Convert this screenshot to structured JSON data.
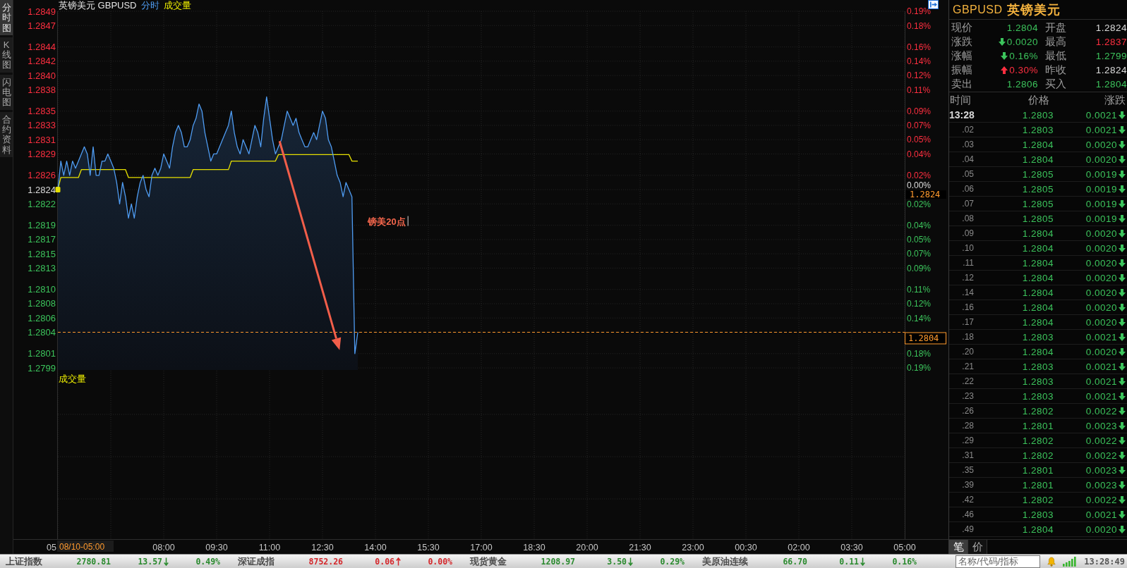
{
  "view_tabs": [
    {
      "label": "分时图",
      "selected": true
    },
    {
      "label": "K线图",
      "selected": false
    },
    {
      "label": "闪电图",
      "selected": false
    },
    {
      "label": "合约资料",
      "selected": false
    }
  ],
  "chart": {
    "volume_legend": "成交量",
    "volume_label": "成交量",
    "reference_tag": "1.2824",
    "crosshair_time": "08/10-05:00",
    "first_time_label": "05",
    "percent_axis": [
      "0.19%",
      "0.18%",
      "0.16%",
      "0.14%",
      "0.12%",
      "0.11%",
      "0.09%",
      "0.07%",
      "0.05%",
      "0.04%",
      "0.02%",
      "0.00%",
      "0.02%",
      "0.04%",
      "0.05%",
      "0.07%",
      "0.09%",
      "0.11%",
      "0.12%",
      "0.14%",
      "0.18%",
      "0.19%"
    ],
    "chart_data": {
      "type": "line",
      "title": "英镑美元 GBPUSD",
      "grid": true,
      "categories": [
        null,
        null,
        null,
        null,
        null,
        null,
        null,
        null,
        null,
        null,
        null,
        null,
        null,
        null,
        null,
        null,
        null,
        null,
        null,
        null,
        null,
        null,
        null,
        null,
        null,
        null,
        null,
        null,
        null,
        null,
        null,
        null,
        null,
        null,
        null,
        null,
        "08:00",
        null,
        null,
        null,
        null,
        null,
        null,
        null,
        null,
        null,
        null,
        null,
        null,
        null,
        null,
        null,
        null,
        null,
        "09:30",
        null,
        null,
        null,
        null,
        null,
        null,
        null,
        null,
        null,
        null,
        null,
        null,
        null,
        null,
        null,
        null,
        null,
        "11:00",
        null,
        null,
        null,
        null,
        null,
        null,
        null,
        null,
        null,
        null,
        null,
        null,
        null,
        null,
        null,
        null,
        null,
        "12:30",
        null,
        null,
        null,
        null,
        null,
        null,
        null,
        null,
        null,
        null,
        null,
        null,
        null,
        null,
        null,
        null,
        null,
        "14:00",
        null,
        null,
        null,
        null,
        null,
        null,
        null,
        null,
        null,
        null,
        null,
        null,
        null,
        null,
        null,
        null,
        null,
        "15:30",
        null,
        null,
        null,
        null,
        null,
        null,
        null,
        null,
        null,
        null,
        null,
        null,
        null,
        null,
        null,
        null,
        null,
        "17:00",
        null,
        null,
        null,
        null,
        null,
        null,
        null,
        null,
        null,
        null,
        null,
        null,
        null,
        null,
        null,
        null,
        null,
        "18:30",
        null,
        null,
        null,
        null,
        null,
        null,
        null,
        null,
        null,
        null,
        null,
        null,
        null,
        null,
        null,
        null,
        null,
        "20:00",
        null,
        null,
        null,
        null,
        null,
        null,
        null,
        null,
        null,
        null,
        null,
        null,
        null,
        null,
        null,
        null,
        null,
        "21:30",
        null,
        null,
        null,
        null,
        null,
        null,
        null,
        null,
        null,
        null,
        null,
        null,
        null,
        null,
        null,
        null,
        null,
        "23:00",
        null,
        null,
        null,
        null,
        null,
        null,
        null,
        null,
        null,
        null,
        null,
        null,
        null,
        null,
        null,
        null,
        null,
        "00:30",
        null,
        null,
        null,
        null,
        null,
        null,
        null,
        null,
        null,
        null,
        null,
        null,
        null,
        null,
        null,
        null,
        null,
        "02:00",
        null,
        null,
        null,
        null,
        null,
        null,
        null,
        null,
        null,
        null,
        null,
        null,
        null,
        null,
        null,
        null,
        null,
        "03:30",
        null,
        null,
        null,
        null,
        null,
        null,
        null,
        null,
        null,
        null,
        null,
        null,
        null,
        null,
        null,
        null,
        null,
        "05:00"
      ],
      "series": [
        {
          "name": "分时",
          "color": "#4f9cf2",
          "values": [
            1.2824,
            1.2828,
            1.2826,
            1.2828,
            1.2826,
            1.2828,
            1.2827,
            1.2828,
            1.2829,
            1.283,
            1.2829,
            1.2826,
            1.283,
            1.2826,
            1.2826,
            1.2828,
            1.2828,
            1.2829,
            1.2828,
            1.2827,
            1.2825,
            1.2822,
            1.2825,
            1.2823,
            1.282,
            1.2822,
            1.282,
            1.2823,
            1.2825,
            1.2826,
            1.2824,
            1.2823,
            1.2826,
            1.2827,
            1.2826,
            1.2827,
            1.2829,
            1.2828,
            1.2827,
            1.283,
            1.2832,
            1.2833,
            1.2832,
            1.283,
            1.283,
            1.2831,
            1.2833,
            1.2834,
            1.2836,
            1.2835,
            1.2832,
            1.283,
            1.2828,
            1.2829,
            1.2829,
            1.283,
            1.2831,
            1.2832,
            1.2833,
            1.2835,
            1.2832,
            1.283,
            1.2829,
            1.2831,
            1.283,
            1.2829,
            1.2831,
            1.2833,
            1.2832,
            1.283,
            1.2834,
            1.2837,
            1.2834,
            1.2831,
            1.2829,
            1.283,
            1.2831,
            1.2833,
            1.2835,
            1.2834,
            1.2833,
            1.2834,
            1.2832,
            1.2831,
            1.283,
            1.283,
            1.2831,
            1.2832,
            1.2831,
            1.2833,
            1.2835,
            1.2834,
            1.2831,
            1.283,
            1.2828,
            1.2826,
            1.2825,
            1.2823,
            1.2825,
            1.2824,
            1.2823,
            1.2801,
            1.2804,
            null,
            null,
            null,
            null,
            null,
            null,
            null,
            null,
            null,
            null,
            null,
            null,
            null,
            null,
            null,
            null,
            null,
            null,
            null,
            null,
            null,
            null,
            null,
            null,
            null,
            null,
            null,
            null,
            null,
            null,
            null,
            null,
            null,
            null,
            null,
            null,
            null,
            null,
            null,
            null,
            null,
            null,
            null,
            null,
            null,
            null,
            null,
            null,
            null,
            null,
            null,
            null,
            null,
            null,
            null,
            null,
            null,
            null,
            null,
            null,
            null,
            null,
            null,
            null,
            null,
            null,
            null,
            null,
            null,
            null,
            null,
            null,
            null,
            null,
            null,
            null,
            null,
            null,
            null,
            null,
            null,
            null,
            null,
            null,
            null,
            null,
            null,
            null,
            null,
            null,
            null,
            null,
            null,
            null,
            null,
            null,
            null,
            null,
            null,
            null,
            null,
            null,
            null,
            null,
            null,
            null,
            null,
            null,
            null,
            null,
            null,
            null,
            null,
            null,
            null,
            null,
            null,
            null,
            null,
            null,
            null,
            null,
            null,
            null,
            null,
            null,
            null,
            null,
            null,
            null,
            null,
            null,
            null,
            null,
            null,
            null,
            null,
            null,
            null,
            null,
            null,
            null,
            null,
            null,
            null,
            null,
            null,
            null,
            null,
            null,
            null,
            null,
            null,
            null,
            null,
            null,
            null,
            null,
            null,
            null,
            null,
            null,
            null,
            null,
            null,
            null,
            null,
            null,
            null,
            null,
            null,
            null,
            null,
            null,
            null,
            null,
            null,
            null,
            null,
            null,
            null,
            null,
            null,
            null,
            null,
            null
          ]
        },
        {
          "color": "#e6e000",
          "values": [
            1.2824,
            1.28257,
            1.28257,
            1.28257,
            1.28257,
            1.28257,
            1.28257,
            1.28257,
            1.28268,
            1.28268,
            1.28268,
            1.28268,
            1.28268,
            1.28268,
            1.28268,
            1.28268,
            1.28268,
            1.28268,
            1.28268,
            1.28268,
            1.28268,
            1.28268,
            1.28268,
            1.28268,
            1.28257,
            1.28257,
            1.28257,
            1.28257,
            1.28257,
            1.28257,
            1.28257,
            1.28257,
            1.28257,
            1.28257,
            1.28257,
            1.28257,
            1.28257,
            1.28257,
            1.28257,
            1.28257,
            1.28257,
            1.28257,
            1.28257,
            1.28257,
            1.28257,
            1.28257,
            1.28268,
            1.28268,
            1.28268,
            1.28268,
            1.28268,
            1.28268,
            1.28268,
            1.28268,
            1.28268,
            1.28268,
            1.28268,
            1.28268,
            1.28268,
            1.2828,
            1.2828,
            1.2828,
            1.2828,
            1.2828,
            1.2828,
            1.2828,
            1.2828,
            1.2828,
            1.2828,
            1.2828,
            1.2828,
            1.2828,
            1.2828,
            1.2828,
            1.2828,
            1.28289,
            1.28289,
            1.28289,
            1.28289,
            1.28289,
            1.28289,
            1.28289,
            1.28289,
            1.28289,
            1.28289,
            1.28289,
            1.28289,
            1.28289,
            1.28289,
            1.28289,
            1.28289,
            1.28289,
            1.28289,
            1.28289,
            1.28289,
            1.28289,
            1.28289,
            1.28289,
            1.28289,
            1.28289,
            1.2828,
            1.2828,
            1.2828,
            null,
            null,
            null,
            null,
            null,
            null,
            null,
            null,
            null,
            null,
            null,
            null,
            null,
            null,
            null,
            null,
            null,
            null,
            null,
            null,
            null,
            null,
            null,
            null,
            null,
            null,
            null,
            null,
            null,
            null,
            null,
            null,
            null,
            null,
            null,
            null,
            null,
            null,
            null,
            null,
            null,
            null,
            null,
            null,
            null,
            null,
            null,
            null,
            null,
            null,
            null,
            null,
            null,
            null,
            null,
            null,
            null,
            null,
            null,
            null,
            null,
            null,
            null,
            null,
            null,
            null,
            null,
            null,
            null,
            null,
            null,
            null,
            null,
            null,
            null,
            null,
            null,
            null,
            null,
            null,
            null,
            null,
            null,
            null,
            null,
            null,
            null,
            null,
            null,
            null,
            null,
            null,
            null,
            null,
            null,
            null,
            null,
            null,
            null,
            null,
            null,
            null,
            null,
            null,
            null,
            null,
            null,
            null,
            null,
            null,
            null,
            null,
            null,
            null,
            null,
            null,
            null,
            null,
            null,
            null,
            null,
            null,
            null,
            null,
            null,
            null,
            null,
            null,
            null,
            null,
            null,
            null,
            null,
            null,
            null,
            null,
            null,
            null,
            null,
            null,
            null,
            null,
            null,
            null,
            null,
            null,
            null,
            null,
            null,
            null,
            null,
            null,
            null,
            null,
            null,
            null,
            null,
            null,
            null,
            null,
            null,
            null,
            null,
            null,
            null,
            null,
            null,
            null,
            null,
            null,
            null,
            null,
            null,
            null,
            null,
            null,
            null,
            null,
            null,
            null,
            null,
            null,
            null,
            null,
            null,
            null
          ]
        }
      ],
      "ylim": [
        1.2775,
        1.2849
      ],
      "yticks": [
        {
          "value": 1.2799,
          "label": "1.2799"
        },
        {
          "value": 1.2801,
          "label": "1.2801"
        },
        {
          "value": 1.2804,
          "label": "1.2804"
        },
        {
          "value": 1.2806,
          "label": "1.2806"
        },
        {
          "value": 1.2808,
          "label": "1.2808"
        },
        {
          "value": 1.281,
          "label": "1.2810"
        },
        {
          "value": 1.2813,
          "label": "1.2813"
        },
        {
          "value": 1.2815,
          "label": "1.2815"
        },
        {
          "value": 1.2817,
          "label": "1.2817"
        },
        {
          "value": 1.2819,
          "label": "1.2819"
        },
        {
          "value": 1.2822,
          "label": "1.2822"
        },
        {
          "value": 1.2824,
          "label": "1.2824"
        },
        {
          "value": 1.2826,
          "label": "1.2826"
        },
        {
          "value": 1.2829,
          "label": "1.2829"
        },
        {
          "value": 1.2831,
          "label": "1.2831"
        },
        {
          "value": 1.2833,
          "label": "1.2833"
        },
        {
          "value": 1.2835,
          "label": "1.2835"
        },
        {
          "value": 1.2838,
          "label": "1.2838"
        },
        {
          "value": 1.284,
          "label": "1.2840"
        },
        {
          "value": 1.2842,
          "label": "1.2842"
        },
        {
          "value": 1.2844,
          "label": "1.2844"
        },
        {
          "value": 1.2847,
          "label": "1.2847"
        },
        {
          "value": 1.2849,
          "label": "1.2849"
        }
      ],
      "ref_lines": [
        {
          "axis": "y",
          "value": 1.2804,
          "label": "1.2804"
        }
      ],
      "annotations": [
        "镑美20点"
      ]
    }
  },
  "quote": {
    "symbol": "GBPUSD",
    "name": "英镑美元",
    "fields": [
      {
        "label": "现价",
        "value": "1.2804",
        "color": "#3cc45c",
        "kind": "plain"
      },
      {
        "label": "开盘",
        "value": "1.2824",
        "color": "#dcdcdc",
        "kind": "plain"
      },
      {
        "label": "涨跌",
        "value": "0.0020",
        "color": "#3cc45c",
        "kind": "down"
      },
      {
        "label": "最高",
        "value": "1.2837",
        "color": "#ff2f40",
        "kind": "plain"
      },
      {
        "label": "涨幅",
        "value": "0.16%",
        "color": "#3cc45c",
        "kind": "down"
      },
      {
        "label": "最低",
        "value": "1.2799",
        "color": "#3cc45c",
        "kind": "plain"
      },
      {
        "label": "振幅",
        "value": "0.30%",
        "color": "#ff2f40",
        "kind": "up"
      },
      {
        "label": "昨收",
        "value": "1.2824",
        "color": "#dcdcdc",
        "kind": "plain"
      },
      {
        "label": "卖出",
        "value": "1.2806",
        "color": "#3cc45c",
        "kind": "plain"
      },
      {
        "label": "买入",
        "value": "1.2804",
        "color": "#3cc45c",
        "kind": "plain"
      }
    ]
  },
  "trades": {
    "columns": [
      "时间",
      "价格",
      "涨跌"
    ],
    "rows": [
      {
        "time": "13:28",
        "price": "1.2803",
        "change": "0.0021",
        "rising": false
      },
      {
        "time": ".02",
        "price": "1.2803",
        "change": "0.0021",
        "rising": false
      },
      {
        "time": ".03",
        "price": "1.2804",
        "change": "0.0020",
        "rising": false
      },
      {
        "time": ".04",
        "price": "1.2804",
        "change": "0.0020",
        "rising": false
      },
      {
        "time": ".05",
        "price": "1.2805",
        "change": "0.0019",
        "rising": false
      },
      {
        "time": ".06",
        "price": "1.2805",
        "change": "0.0019",
        "rising": false
      },
      {
        "time": ".07",
        "price": "1.2805",
        "change": "0.0019",
        "rising": false
      },
      {
        "time": ".08",
        "price": "1.2805",
        "change": "0.0019",
        "rising": false
      },
      {
        "time": ".09",
        "price": "1.2804",
        "change": "0.0020",
        "rising": false
      },
      {
        "time": ".10",
        "price": "1.2804",
        "change": "0.0020",
        "rising": false
      },
      {
        "time": ".11",
        "price": "1.2804",
        "change": "0.0020",
        "rising": false
      },
      {
        "time": ".12",
        "price": "1.2804",
        "change": "0.0020",
        "rising": false
      },
      {
        "time": ".14",
        "price": "1.2804",
        "change": "0.0020",
        "rising": false
      },
      {
        "time": ".16",
        "price": "1.2804",
        "change": "0.0020",
        "rising": false
      },
      {
        "time": ".17",
        "price": "1.2804",
        "change": "0.0020",
        "rising": false
      },
      {
        "time": ".18",
        "price": "1.2803",
        "change": "0.0021",
        "rising": false
      },
      {
        "time": ".20",
        "price": "1.2804",
        "change": "0.0020",
        "rising": false
      },
      {
        "time": ".21",
        "price": "1.2803",
        "change": "0.0021",
        "rising": false
      },
      {
        "time": ".22",
        "price": "1.2803",
        "change": "0.0021",
        "rising": false
      },
      {
        "time": ".23",
        "price": "1.2803",
        "change": "0.0021",
        "rising": false
      },
      {
        "time": ".26",
        "price": "1.2802",
        "change": "0.0022",
        "rising": false
      },
      {
        "time": ".28",
        "price": "1.2801",
        "change": "0.0023",
        "rising": false
      },
      {
        "time": ".29",
        "price": "1.2802",
        "change": "0.0022",
        "rising": false
      },
      {
        "time": ".31",
        "price": "1.2802",
        "change": "0.0022",
        "rising": false
      },
      {
        "time": ".35",
        "price": "1.2801",
        "change": "0.0023",
        "rising": false
      },
      {
        "time": ".39",
        "price": "1.2801",
        "change": "0.0023",
        "rising": false
      },
      {
        "time": ".42",
        "price": "1.2802",
        "change": "0.0022",
        "rising": false
      },
      {
        "time": ".46",
        "price": "1.2803",
        "change": "0.0021",
        "rising": false
      },
      {
        "time": ".49",
        "price": "1.2804",
        "change": "0.0020",
        "rising": false
      }
    ]
  },
  "side_tabs": [
    {
      "label": "笔",
      "selected": true
    },
    {
      "label": "价",
      "selected": false
    }
  ],
  "status_bar": {
    "items": [
      {
        "name": "上证指数",
        "price": "2780.81",
        "change": "13.57",
        "percent": "0.49%",
        "rising": false
      },
      {
        "name": "深证成指",
        "price": "8752.26",
        "change": "0.06",
        "percent": "0.00%",
        "rising": true
      },
      {
        "name": "现货黄金",
        "price": "1208.97",
        "change": "3.50",
        "percent": "0.29%",
        "rising": false
      },
      {
        "name": "美原油连续",
        "price": "66.70",
        "change": "0.11",
        "percent": "0.16%",
        "rising": false
      }
    ],
    "search": {
      "placeholder": "名称/代码/指标"
    },
    "clock": "13:28:49"
  }
}
